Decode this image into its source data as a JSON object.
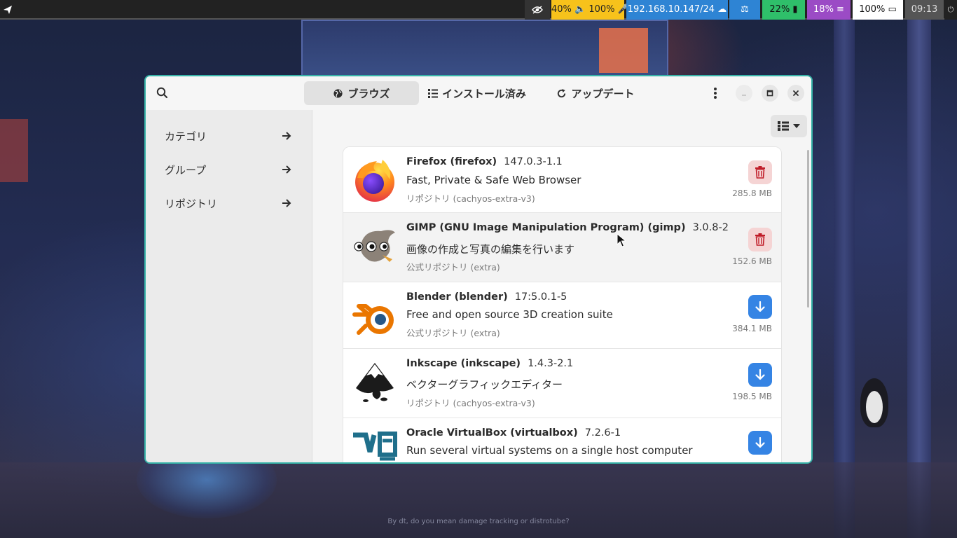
{
  "desktop": {
    "caption": "By dt, do you mean damage tracking or distrotube?"
  },
  "topbar": {
    "audio": "40% 🔈 100% 🎤",
    "network": "192.168.10.147/24 ☁",
    "balance": "⚖",
    "battery": "22% ▮",
    "cpu": "18% ≡",
    "brightness": "100% ▭",
    "clock": "09:13",
    "power": "⏻",
    "colors": {
      "audio": "#f7c21b",
      "network": "#2e84d4",
      "battery": "#2fbf6a",
      "cpu": "#9b4bc5"
    }
  },
  "window": {
    "accent": "#36b3a8",
    "tabs": [
      {
        "label": "ブラウズ",
        "icon": "globe-icon",
        "active": true
      },
      {
        "label": "インストール済み",
        "icon": "list-icon",
        "active": false
      },
      {
        "label": "アップデート",
        "icon": "refresh-icon",
        "active": false
      }
    ]
  },
  "sidebar": {
    "items": [
      {
        "label": "カテゴリ"
      },
      {
        "label": "グループ"
      },
      {
        "label": "リポジトリ"
      }
    ]
  },
  "packages": [
    {
      "name": "Firefox (firefox)",
      "version": "147.0.3-1.1",
      "description": "Fast, Private & Safe Web Browser",
      "repo": "リポジトリ (cachyos-extra-v3)",
      "size": "285.8 MB",
      "action": "remove",
      "icon": "firefox-icon"
    },
    {
      "name": "GIMP (GNU Image Manipulation Program) (gimp)",
      "version": "3.0.8-2",
      "description": "画像の作成と写真の編集を行います",
      "repo": "公式リポジトリ (extra)",
      "size": "152.6 MB",
      "action": "remove",
      "icon": "gimp-icon"
    },
    {
      "name": "Blender (blender)",
      "version": "17:5.0.1-5",
      "description": "Free and open source 3D creation suite",
      "repo": "公式リポジトリ (extra)",
      "size": "384.1 MB",
      "action": "install",
      "icon": "blender-icon"
    },
    {
      "name": "Inkscape (inkscape)",
      "version": "1.4.3-2.1",
      "description": "ベクターグラフィックエディター",
      "repo": "リポジトリ (cachyos-extra-v3)",
      "size": "198.5 MB",
      "action": "install",
      "icon": "inkscape-icon"
    },
    {
      "name": "Oracle VirtualBox (virtualbox)",
      "version": "7.2.6-1",
      "description": "Run several virtual systems on a single host computer",
      "repo": "",
      "size": "",
      "action": "install",
      "icon": "virtualbox-icon"
    }
  ],
  "colors": {
    "remove_bg": "#f5d4d4",
    "remove_fg": "#c01c28",
    "install_bg": "#3584e4"
  }
}
